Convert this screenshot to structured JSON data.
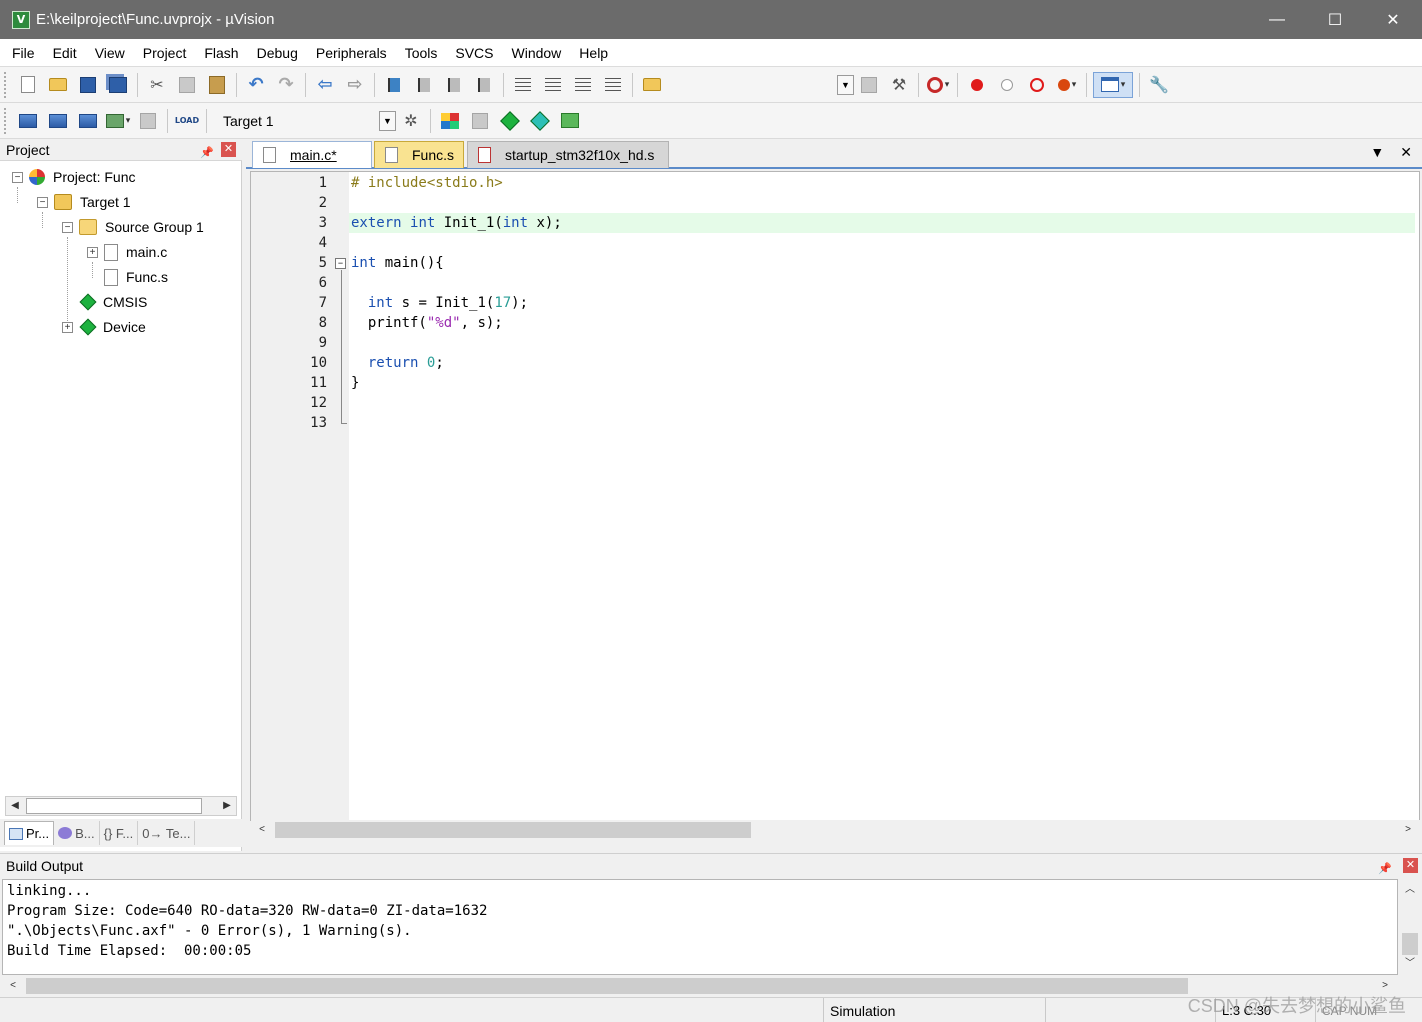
{
  "window": {
    "title": "E:\\keilproject\\Func.uvprojx - µVision",
    "app_icon": "V",
    "controls": [
      "—",
      "☐",
      "✕"
    ]
  },
  "menu": [
    "File",
    "Edit",
    "View",
    "Project",
    "Flash",
    "Debug",
    "Peripherals",
    "Tools",
    "SVCS",
    "Window",
    "Help"
  ],
  "toolbar": {
    "target_select": "Target 1",
    "load_label": "LOAD"
  },
  "project_panel": {
    "title": "Project",
    "tree": {
      "project": "Project: Func",
      "target": "Target 1",
      "group": "Source Group 1",
      "file1": "main.c",
      "file2": "Func.s",
      "cmsis": "CMSIS",
      "device": "Device"
    },
    "tabs": [
      "Pr...",
      "B...",
      "{} F...",
      "0→ Te..."
    ]
  },
  "editor_tabs": [
    {
      "label": "main.c*"
    },
    {
      "label": "Func.s"
    },
    {
      "label": "startup_stm32f10x_hd.s"
    }
  ],
  "code": {
    "line_numbers": [
      "1",
      "2",
      "3",
      "4",
      "5",
      "6",
      "7",
      "8",
      "9",
      "10",
      "11",
      "12",
      "13"
    ],
    "l1": "# include<stdio.h>",
    "l3_kw1": "extern",
    "l3_kw2": "int",
    "l3_mid": " Init_1(",
    "l3_kw3": "int",
    "l3_end": " x);",
    "l5_kw": "int",
    "l5_rest": " main(){",
    "l7_kw": "int",
    "l7_mid": " s = Init_1(",
    "l7_num": "17",
    "l7_end": ");",
    "l8_a": "printf(",
    "l8_str": "\"%d\"",
    "l8_b": ", s);",
    "l10_kw": "return",
    "l10_num": "0",
    "l10_end": ";",
    "l11": "}"
  },
  "build_output": {
    "title": "Build Output",
    "lines": [
      "linking...",
      "Program Size: Code=640 RO-data=320 RW-data=0 ZI-data=1632",
      "\".\\Objects\\Func.axf\" - 0 Error(s), 1 Warning(s).",
      "Build Time Elapsed:  00:00:05"
    ]
  },
  "status": {
    "mode": "Simulation",
    "position": "L:3 C:30",
    "keys": "CAP NUM"
  },
  "watermark": "CSDN @失去梦想的小鲨鱼"
}
